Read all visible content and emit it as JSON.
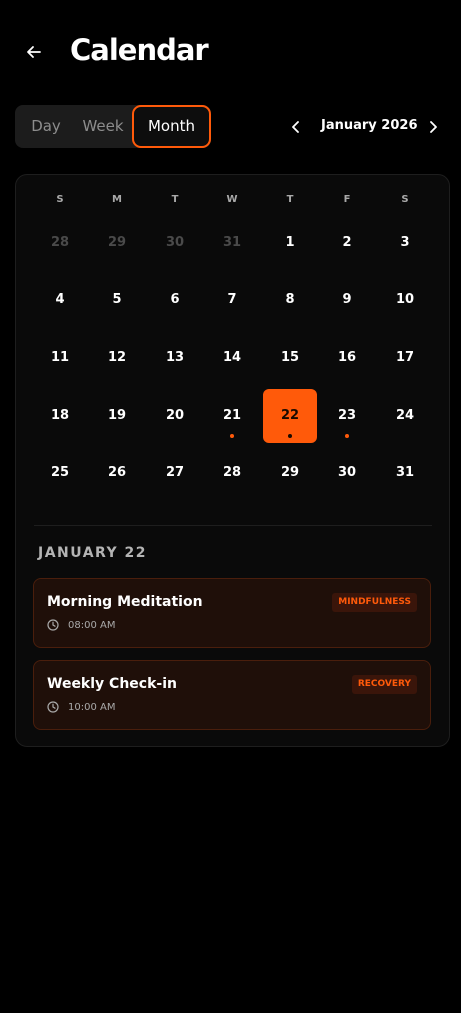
{
  "header": {
    "title": "Calendar",
    "back_icon": "arrow-left-icon"
  },
  "view_switcher": {
    "options": [
      "Day",
      "Week",
      "Month"
    ],
    "selected": "Month"
  },
  "month_nav": {
    "label": "January 2026",
    "prev_icon": "chevron-left-icon",
    "next_icon": "chevron-right-icon"
  },
  "calendar": {
    "weekdays": [
      "S",
      "M",
      "T",
      "W",
      "T",
      "F",
      "S"
    ],
    "weeks": [
      [
        {
          "d": "28",
          "muted": true
        },
        {
          "d": "29",
          "muted": true
        },
        {
          "d": "30",
          "muted": true
        },
        {
          "d": "31",
          "muted": true
        },
        {
          "d": "1"
        },
        {
          "d": "2"
        },
        {
          "d": "3"
        }
      ],
      [
        {
          "d": "4"
        },
        {
          "d": "5"
        },
        {
          "d": "6"
        },
        {
          "d": "7"
        },
        {
          "d": "8"
        },
        {
          "d": "9"
        },
        {
          "d": "10"
        }
      ],
      [
        {
          "d": "11"
        },
        {
          "d": "12"
        },
        {
          "d": "13"
        },
        {
          "d": "14"
        },
        {
          "d": "15"
        },
        {
          "d": "16"
        },
        {
          "d": "17"
        }
      ],
      [
        {
          "d": "18"
        },
        {
          "d": "19"
        },
        {
          "d": "20"
        },
        {
          "d": "21",
          "dot": true
        },
        {
          "d": "22",
          "dot": true,
          "selected": true
        },
        {
          "d": "23",
          "dot": true
        },
        {
          "d": "24"
        }
      ],
      [
        {
          "d": "25"
        },
        {
          "d": "26"
        },
        {
          "d": "27"
        },
        {
          "d": "28"
        },
        {
          "d": "29"
        },
        {
          "d": "30"
        },
        {
          "d": "31"
        }
      ]
    ],
    "accent_color": "#ff5a0a"
  },
  "agenda": {
    "date_heading": "JANUARY 22",
    "events": [
      {
        "title": "Morning Meditation",
        "time": "08:00 AM",
        "tag": "MINDFULNESS"
      },
      {
        "title": "Weekly Check-in",
        "time": "10:00 AM",
        "tag": "RECOVERY"
      }
    ]
  }
}
